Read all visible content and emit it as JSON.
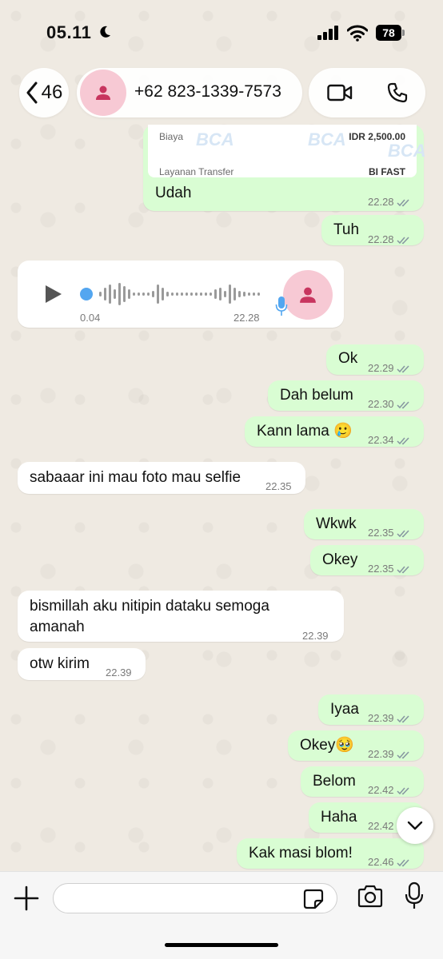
{
  "status_bar": {
    "time": "05.11",
    "battery": "78"
  },
  "header": {
    "back_count": "46",
    "contact_name": "+62 823-1339-7573"
  },
  "receipt": {
    "fee_label": "Biaya",
    "fee_value": "IDR 2,500.00",
    "service_label": "Layanan Transfer",
    "service_value": "BI FAST",
    "watermark": "BCA"
  },
  "voice_note": {
    "elapsed": "0.04",
    "time": "22.28"
  },
  "messages": [
    {
      "dir": "out",
      "text": "Udah",
      "time": "22.28"
    },
    {
      "dir": "out",
      "text": "Tuh",
      "time": "22.28"
    },
    {
      "dir": "out",
      "text": "Ok",
      "time": "22.29"
    },
    {
      "dir": "out",
      "text": "Dah belum",
      "time": "22.30"
    },
    {
      "dir": "out",
      "text": "Kann lama 🥲",
      "time": "22.34"
    },
    {
      "dir": "in",
      "text": "sabaaar ini mau foto mau selfie",
      "time": "22.35"
    },
    {
      "dir": "out",
      "text": "Wkwk",
      "time": "22.35"
    },
    {
      "dir": "out",
      "text": "Okey",
      "time": "22.35"
    },
    {
      "dir": "in",
      "text_line1": "bismillah aku nitipin dataku semoga",
      "text_line2": "amanah",
      "time": "22.39"
    },
    {
      "dir": "in",
      "text": "otw kirim",
      "time": "22.39"
    },
    {
      "dir": "out",
      "text": "Iyaa",
      "time": "22.39"
    },
    {
      "dir": "out",
      "text": "Okey🥹",
      "time": "22.39"
    },
    {
      "dir": "out",
      "text": "Belom",
      "time": "22.42"
    },
    {
      "dir": "out",
      "text": "Haha",
      "time": "22.42"
    },
    {
      "dir": "out",
      "text": "Kak masi blom!",
      "time": "22.46"
    }
  ],
  "composer": {
    "placeholder": ""
  },
  "colors": {
    "outgoing": "#d9fdd3",
    "incoming": "#ffffff",
    "tick": "#8696a0",
    "voice_dot": "#53a6f0",
    "avatar_bg": "#f7c9d4",
    "avatar_fg": "#c8355f"
  }
}
